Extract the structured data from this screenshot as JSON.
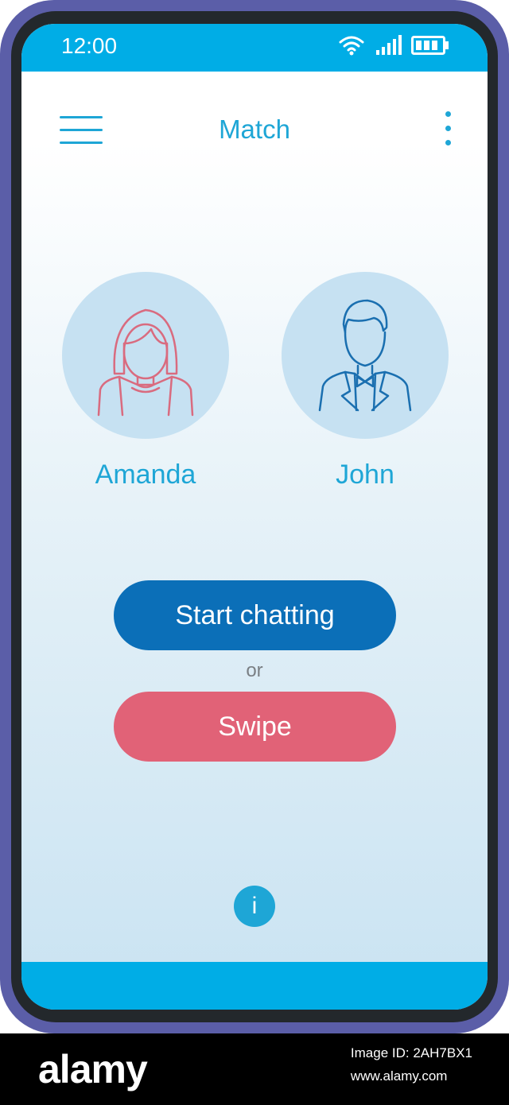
{
  "status_bar": {
    "time": "12:00"
  },
  "app_bar": {
    "title": "Match"
  },
  "profiles": [
    {
      "name": "Amanda"
    },
    {
      "name": "John"
    }
  ],
  "actions": {
    "start_chatting": "Start chatting",
    "separator": "or",
    "swipe": "Swipe",
    "info": "i"
  },
  "colors": {
    "accent": "#1ea6d6",
    "status_bar": "#00ade6",
    "primary_button": "#0b6fb8",
    "secondary_button": "#e16277",
    "phone_frame": "#5b5ea8",
    "avatar_circle": "#c6e1f2"
  },
  "icons": [
    "wifi-icon",
    "signal-icon",
    "battery-icon",
    "hamburger-menu-icon",
    "more-vertical-icon",
    "female-avatar-icon",
    "male-avatar-icon",
    "info-icon"
  ],
  "footer": {
    "brand": "alamy",
    "image_id_label": "Image ID: 2AH7BX1",
    "site": "www.alamy.com"
  }
}
